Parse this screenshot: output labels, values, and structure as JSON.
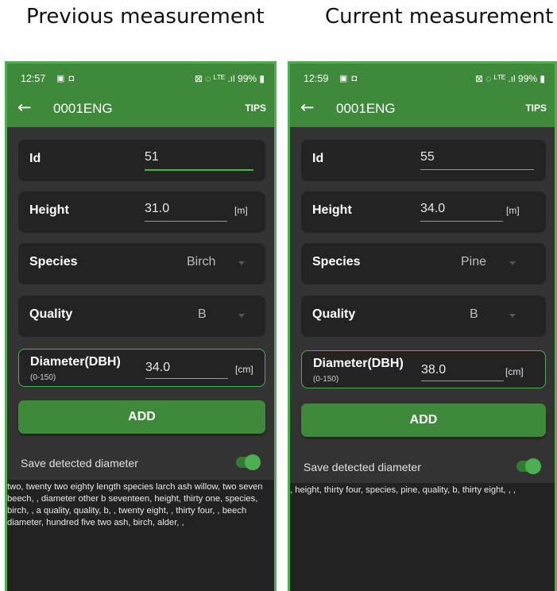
{
  "headings": {
    "previous": "Previous measurement",
    "current": "Current measurement"
  },
  "icons": {
    "status_left": "image-icon, video-icon",
    "status_right": "battery-saver-icon, wifi-icon, volte-icon, signal-icon, battery-icon",
    "toolbar_back": "arrow-left-icon",
    "dropdown": "caret-down-icon"
  },
  "colors": {
    "app_green": "#3f8a3a",
    "accent_green": "#4caf50",
    "background": "#333333",
    "card": "#232323"
  },
  "previous": {
    "status": {
      "time": "12:57",
      "left_icons": "▣ ◘",
      "right": "⊠ ◌ ᴸᵀᴱ .ıl 99% ▮"
    },
    "toolbar": {
      "back": "←",
      "title": "0001ENG",
      "tips": "TIPS"
    },
    "fields": {
      "id_label": "Id",
      "id_value": "51",
      "height_label": "Height",
      "height_value": "31.0",
      "height_unit": "[m]",
      "species_label": "Species",
      "species_value": "Birch",
      "quality_label": "Quality",
      "quality_value": "B",
      "diameter_label": "Diameter(DBH)",
      "diameter_range": "(0-150)",
      "diameter_value": "34.0",
      "diameter_unit": "[cm]"
    },
    "add_label": "ADD",
    "save_label": "Save detected diameter",
    "save_enabled": true,
    "transcript": "two, twenty two eighty length species larch ash willow, two seven beech, , diameter other b seventeen, height, thirty one, species, birch, , a quality, quality, b, , twenty eight, , thirty four, , beech diameter, hundred five two ash, birch, alder, ,"
  },
  "current": {
    "status": {
      "time": "12:59",
      "left_icons": "▣ ◘",
      "right": "⊠ ◌ ᴸᵀᴱ .ıl 99% ▮"
    },
    "toolbar": {
      "back": "←",
      "title": "0001ENG",
      "tips": "TIPS"
    },
    "fields": {
      "id_label": "Id",
      "id_value": "55",
      "height_label": "Height",
      "height_value": "34.0",
      "height_unit": "[m]",
      "species_label": "Species",
      "species_value": "Pine",
      "quality_label": "Quality",
      "quality_value": "B",
      "diameter_label": "Diameter(DBH)",
      "diameter_range": "(0-150)",
      "diameter_value": "38.0",
      "diameter_unit": "[cm]"
    },
    "add_label": "ADD",
    "save_label": "Save detected diameter",
    "save_enabled": true,
    "transcript": ", height, thirty four, species, pine, quality, b, thirty eight, , ,"
  }
}
